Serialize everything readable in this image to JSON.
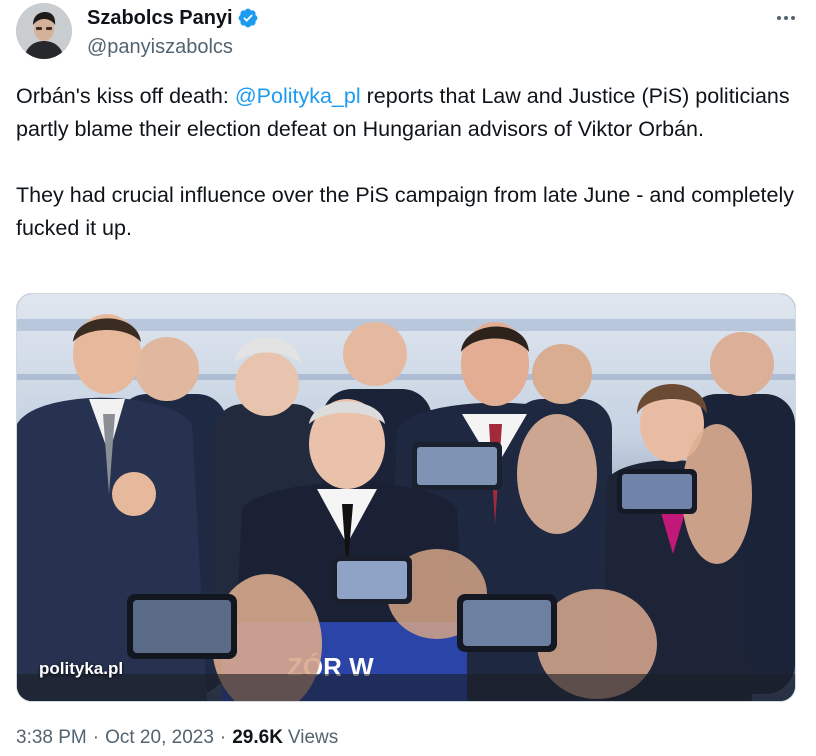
{
  "author": {
    "display_name": "Szabolcs Panyi",
    "handle": "@panyiszabolcs",
    "verified": true
  },
  "icons": {
    "verified": "verified-badge-icon",
    "more": "more-options-icon"
  },
  "tweet": {
    "p1_before": "Orbán's kiss off death: ",
    "mention": "@Polityka_pl",
    "p1_after": " reports that Law and Justice (PiS) politicians partly blame their election defeat on Hungarian advisors of Viktor Orbán.",
    "p2": "They had crucial influence over the PiS campaign from late June - and completely fucked it up."
  },
  "media": {
    "watermark": "polityka.pl",
    "banner_text": "ZÓR W"
  },
  "meta": {
    "time": "3:38 PM",
    "separator": "·",
    "date": "Oct 20, 2023",
    "views_count": "29.6K",
    "views_label": "Views"
  },
  "colors": {
    "link": "#1d9bf0",
    "text": "#0f1419",
    "secondary": "#536471",
    "verified": "#1d9bf0"
  }
}
